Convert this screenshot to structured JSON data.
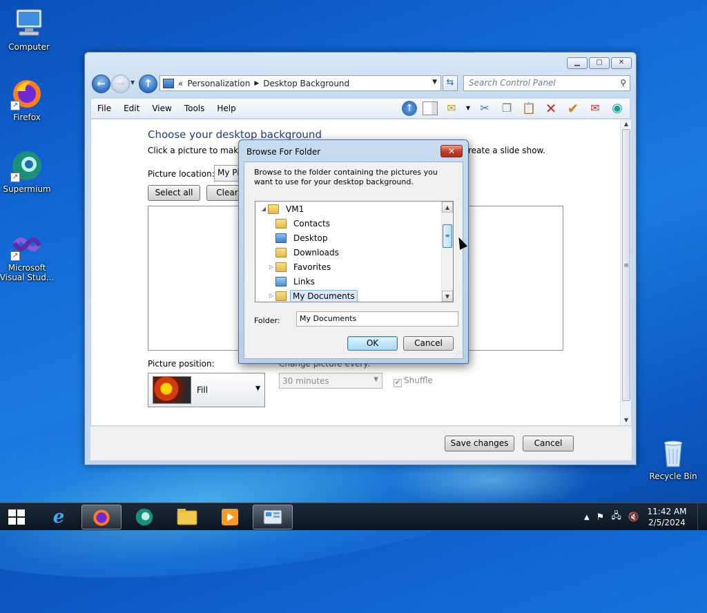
{
  "desktop": {
    "icons": [
      {
        "label": "Computer",
        "icon": "computer-icon"
      },
      {
        "label": "Firefox",
        "icon": "firefox-icon"
      },
      {
        "label": "Supermium",
        "icon": "supermium-icon"
      },
      {
        "label": "Microsoft Visual Stud...",
        "icon": "visual-studio-icon"
      },
      {
        "label": "Recycle Bin",
        "icon": "recycle-bin-icon"
      }
    ]
  },
  "window": {
    "address": {
      "prefix": "«",
      "segments": [
        "Personalization",
        "Desktop Background"
      ]
    },
    "search_placeholder": "Search Control Panel",
    "menu": [
      "File",
      "Edit",
      "View",
      "Tools",
      "Help"
    ],
    "page": {
      "title": "Choose your desktop background",
      "subtitle": "Click a picture to make it",
      "subtitle_tail": "reate a slide show.",
      "location_label": "Picture location:",
      "location_value": "My Pi",
      "select_all": "Select all",
      "clear_all": "Clear",
      "position_label": "Picture position:",
      "position_value": "Fill",
      "change_label": "Change picture every:",
      "change_value": "30 minutes",
      "shuffle_label": "Shuffle"
    },
    "footer": {
      "save": "Save changes",
      "cancel": "Cancel"
    }
  },
  "dialog": {
    "title": "Browse For Folder",
    "description": "Browse to the folder containing the pictures you want to use for your desktop background.",
    "tree": [
      {
        "label": "VM1",
        "depth": 0,
        "expander": "◢",
        "selected": false
      },
      {
        "label": "Contacts",
        "depth": 1,
        "expander": "",
        "selected": false
      },
      {
        "label": "Desktop",
        "depth": 1,
        "expander": "",
        "selected": false
      },
      {
        "label": "Downloads",
        "depth": 1,
        "expander": "",
        "selected": false
      },
      {
        "label": "Favorites",
        "depth": 1,
        "expander": "▷",
        "selected": false
      },
      {
        "label": "Links",
        "depth": 1,
        "expander": "",
        "selected": false
      },
      {
        "label": "My Documents",
        "depth": 1,
        "expander": "▷",
        "selected": true
      }
    ],
    "folder_label": "Folder:",
    "folder_value": "My Documents",
    "ok": "OK",
    "cancel": "Cancel"
  },
  "taskbar": {
    "time": "11:42 AM",
    "date": "2/5/2024"
  }
}
